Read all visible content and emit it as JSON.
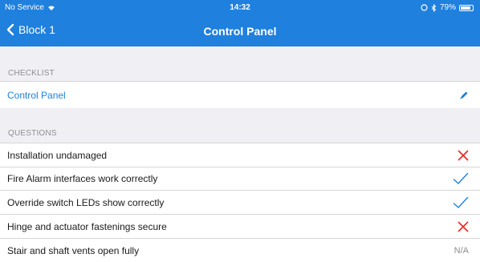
{
  "statusbar": {
    "carrier": "No Service",
    "time": "14:32",
    "battery": "79%"
  },
  "navbar": {
    "back_label": "Block 1",
    "title": "Control Panel"
  },
  "checklist": {
    "header": "CHECKLIST",
    "item": "Control Panel"
  },
  "questions": {
    "header": "QUESTIONS",
    "items": [
      {
        "label": "Installation undamaged",
        "status": "fail"
      },
      {
        "label": "Fire Alarm interfaces work correctly",
        "status": "pass"
      },
      {
        "label": "Override switch LEDs show correctly",
        "status": "pass"
      },
      {
        "label": "Hinge and actuator fastenings secure",
        "status": "fail"
      },
      {
        "label": "Stair and shaft vents open fully",
        "status": "na",
        "status_text": "N/A"
      }
    ]
  },
  "colors": {
    "accent": "#1f80de",
    "fail": "#e8322e",
    "pass": "#1f80de"
  }
}
